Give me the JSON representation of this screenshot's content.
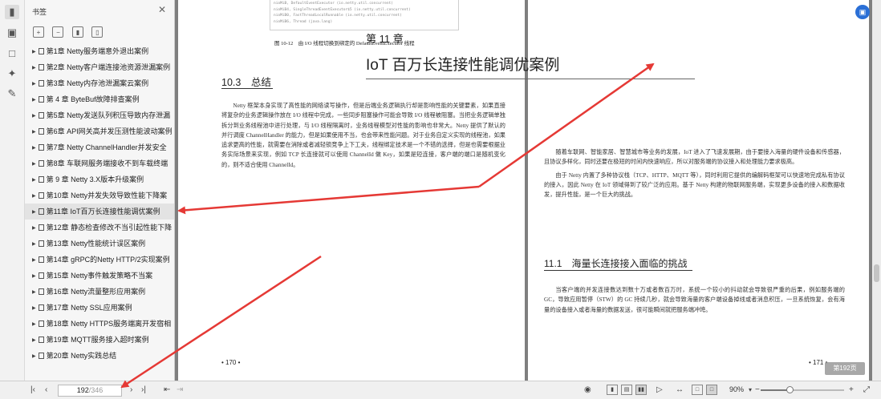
{
  "sidebar_rail": {
    "icons": [
      "bookmark-icon",
      "thumbnail-icon",
      "comment-icon",
      "attachment-icon",
      "signature-icon"
    ]
  },
  "bookmarks_panel": {
    "title": "书签",
    "items": [
      "第1章 Netty服务端意外退出案例",
      "第2章 Netty客户端连接池资源泄漏案例",
      "第3章 Netty内存池泄漏案云案例",
      "第 4 章 ByteBuf故障排查案例",
      "第5章 Netty发送队列积压导致内存泄漏",
      "第6章 API网关高并发压测性能波动案例",
      "第7章 Netty ChannelHandler并发安全",
      "第8章 车联网服务端接收不到车载终端",
      "第 9 章 Netty 3.X版本升级案例",
      "第10章 Netty并发失效导致性能下降案",
      "第11章 IoT百万长连接性能调优案例",
      "第12章 静态检查修改不当引起性能下降",
      "第13章 Netty性能统计误区案例",
      "第14章 gRPC的Netty HTTP/2实现案例",
      "第15章 Netty事件触发策略不当案",
      "第16章 Netty流量整形应用案例",
      "第17章 Netty SSL应用案例",
      "第18章 Netty HTTPS服务端离开发宿相",
      "第19章 MQTT服务接入超时案例",
      "第20章 Netty实践总结"
    ],
    "selected_index": 10
  },
  "left_page": {
    "figure_lines": [
      "nioMiB, DefaultEventExecutor (io.netty.util.concurrent)",
      "nioMiB4, SingleThreadEventExecutor$5 (io.netty.util.concurrent)",
      "nioMiB0, FastThreadLocalRunnable (io.netty.util.concurrent)",
      "nioMiB6, Thread (java.lang)"
    ],
    "figure_caption": "图 10-12　由 I/O 线程切换到绑定的 DefaultEventExecutor 线程",
    "section_title": "10.3　总结",
    "paragraph": "Netty 框架本身实现了高性能的网络读写操作，但是后端业务逻辑执行却是影响性能的关键要素，如果直接将复杂的业务逻辑操作放在 I/O 线程中完成，一些同步阻塞操作可能会导致 I/O 线程被阻塞。当把业务逻辑单独拆分到业务线程池中进行处理，与 I/O 线程隔离时，业务线程模型对性能的影响也非常大。Netty 提供了默认的并行调度 ChannelHandler 的能力，但是如果使用不当，也会带来性能问题。对于业务自定义实现的线程池，如果追求更高的性能，就需要在消除或者减轻锁竞争上下工夫，线程绑定技术是一个不错的选择，但是也需要根据业务实际场景来实现，例如 TCP 长连接就可以使用 ChannelId 做 Key，如果是短连接，客户端的端口是随机变化的，则不适合使用 ChannelId。",
    "page_number": "• 170 •"
  },
  "right_page": {
    "chapter_label": "第 11 章",
    "chapter_title": "IoT 百万长连接性能调优案例",
    "paragraph1": "随着车联网、智能家居、智慧城市等业务的发展，IoT 进入了飞速发展期，由于要接入海量的硬件设备和传感器，且协议多样化，同时还要在极短的时间内快速响应，所以对服务端的协议接入和处理能力要求极高。",
    "paragraph2": "由于 Netty 内置了多种协议栈（TCP、HTTP、MQTT 等），同时利用它提供的编解码框架可以快速地完成私有协议的接入，因此 Netty 在 IoT 领域得到了较广泛的应用。基于 Netty 构建的物联网服务端，实现更多设备的接入和数据收发，提升性能，是一个巨大的挑战。",
    "section_title": "11.1　海量长连接接入面临的挑战",
    "paragraph3": "当客户端的并发连接数达到数十万或者数百万时，系统一个较小的抖动就会导致很严重的后果，例如服务端的 GC，导致应用暂停（STW）的 GC 持续几秒，就会导致海量的客户端设备掉线或者消息积压，一旦系统恢复，会有海量的设备接入或者海量的数据发送，很可能瞬间就把服务端冲垮。",
    "page_number": "• 171 •"
  },
  "page_badge": "第192页",
  "status_bar": {
    "current_page": "192",
    "total_pages": "/346",
    "zoom": "90%",
    "zoom_level_percent": 90
  },
  "colors": {
    "arrow": "#e53935",
    "accent": "#2a6fd6"
  }
}
